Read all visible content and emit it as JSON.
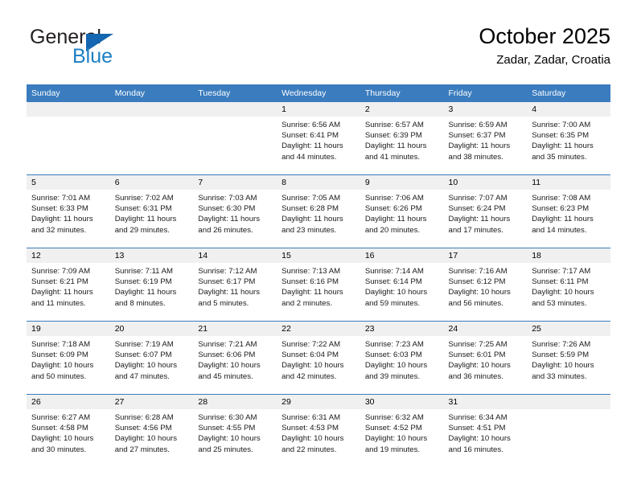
{
  "brand": {
    "name_general": "General",
    "name_blue": "Blue",
    "accent_color": "#1566b0",
    "blue_text_color": "#1c7fc4"
  },
  "header": {
    "title": "October 2025",
    "subtitle": "Zadar, Zadar, Croatia"
  },
  "calendar": {
    "header_bg": "#3a7cbe",
    "daynum_bg": "#f0f0f0",
    "weekday_headers": [
      "Sunday",
      "Monday",
      "Tuesday",
      "Wednesday",
      "Thursday",
      "Friday",
      "Saturday"
    ],
    "weeks": [
      [
        {
          "day": "",
          "sunrise": "",
          "sunset": "",
          "daylight_line1": "",
          "daylight_line2": ""
        },
        {
          "day": "",
          "sunrise": "",
          "sunset": "",
          "daylight_line1": "",
          "daylight_line2": ""
        },
        {
          "day": "",
          "sunrise": "",
          "sunset": "",
          "daylight_line1": "",
          "daylight_line2": ""
        },
        {
          "day": "1",
          "sunrise": "Sunrise: 6:56 AM",
          "sunset": "Sunset: 6:41 PM",
          "daylight_line1": "Daylight: 11 hours",
          "daylight_line2": "and 44 minutes."
        },
        {
          "day": "2",
          "sunrise": "Sunrise: 6:57 AM",
          "sunset": "Sunset: 6:39 PM",
          "daylight_line1": "Daylight: 11 hours",
          "daylight_line2": "and 41 minutes."
        },
        {
          "day": "3",
          "sunrise": "Sunrise: 6:59 AM",
          "sunset": "Sunset: 6:37 PM",
          "daylight_line1": "Daylight: 11 hours",
          "daylight_line2": "and 38 minutes."
        },
        {
          "day": "4",
          "sunrise": "Sunrise: 7:00 AM",
          "sunset": "Sunset: 6:35 PM",
          "daylight_line1": "Daylight: 11 hours",
          "daylight_line2": "and 35 minutes."
        }
      ],
      [
        {
          "day": "5",
          "sunrise": "Sunrise: 7:01 AM",
          "sunset": "Sunset: 6:33 PM",
          "daylight_line1": "Daylight: 11 hours",
          "daylight_line2": "and 32 minutes."
        },
        {
          "day": "6",
          "sunrise": "Sunrise: 7:02 AM",
          "sunset": "Sunset: 6:31 PM",
          "daylight_line1": "Daylight: 11 hours",
          "daylight_line2": "and 29 minutes."
        },
        {
          "day": "7",
          "sunrise": "Sunrise: 7:03 AM",
          "sunset": "Sunset: 6:30 PM",
          "daylight_line1": "Daylight: 11 hours",
          "daylight_line2": "and 26 minutes."
        },
        {
          "day": "8",
          "sunrise": "Sunrise: 7:05 AM",
          "sunset": "Sunset: 6:28 PM",
          "daylight_line1": "Daylight: 11 hours",
          "daylight_line2": "and 23 minutes."
        },
        {
          "day": "9",
          "sunrise": "Sunrise: 7:06 AM",
          "sunset": "Sunset: 6:26 PM",
          "daylight_line1": "Daylight: 11 hours",
          "daylight_line2": "and 20 minutes."
        },
        {
          "day": "10",
          "sunrise": "Sunrise: 7:07 AM",
          "sunset": "Sunset: 6:24 PM",
          "daylight_line1": "Daylight: 11 hours",
          "daylight_line2": "and 17 minutes."
        },
        {
          "day": "11",
          "sunrise": "Sunrise: 7:08 AM",
          "sunset": "Sunset: 6:23 PM",
          "daylight_line1": "Daylight: 11 hours",
          "daylight_line2": "and 14 minutes."
        }
      ],
      [
        {
          "day": "12",
          "sunrise": "Sunrise: 7:09 AM",
          "sunset": "Sunset: 6:21 PM",
          "daylight_line1": "Daylight: 11 hours",
          "daylight_line2": "and 11 minutes."
        },
        {
          "day": "13",
          "sunrise": "Sunrise: 7:11 AM",
          "sunset": "Sunset: 6:19 PM",
          "daylight_line1": "Daylight: 11 hours",
          "daylight_line2": "and 8 minutes."
        },
        {
          "day": "14",
          "sunrise": "Sunrise: 7:12 AM",
          "sunset": "Sunset: 6:17 PM",
          "daylight_line1": "Daylight: 11 hours",
          "daylight_line2": "and 5 minutes."
        },
        {
          "day": "15",
          "sunrise": "Sunrise: 7:13 AM",
          "sunset": "Sunset: 6:16 PM",
          "daylight_line1": "Daylight: 11 hours",
          "daylight_line2": "and 2 minutes."
        },
        {
          "day": "16",
          "sunrise": "Sunrise: 7:14 AM",
          "sunset": "Sunset: 6:14 PM",
          "daylight_line1": "Daylight: 10 hours",
          "daylight_line2": "and 59 minutes."
        },
        {
          "day": "17",
          "sunrise": "Sunrise: 7:16 AM",
          "sunset": "Sunset: 6:12 PM",
          "daylight_line1": "Daylight: 10 hours",
          "daylight_line2": "and 56 minutes."
        },
        {
          "day": "18",
          "sunrise": "Sunrise: 7:17 AM",
          "sunset": "Sunset: 6:11 PM",
          "daylight_line1": "Daylight: 10 hours",
          "daylight_line2": "and 53 minutes."
        }
      ],
      [
        {
          "day": "19",
          "sunrise": "Sunrise: 7:18 AM",
          "sunset": "Sunset: 6:09 PM",
          "daylight_line1": "Daylight: 10 hours",
          "daylight_line2": "and 50 minutes."
        },
        {
          "day": "20",
          "sunrise": "Sunrise: 7:19 AM",
          "sunset": "Sunset: 6:07 PM",
          "daylight_line1": "Daylight: 10 hours",
          "daylight_line2": "and 47 minutes."
        },
        {
          "day": "21",
          "sunrise": "Sunrise: 7:21 AM",
          "sunset": "Sunset: 6:06 PM",
          "daylight_line1": "Daylight: 10 hours",
          "daylight_line2": "and 45 minutes."
        },
        {
          "day": "22",
          "sunrise": "Sunrise: 7:22 AM",
          "sunset": "Sunset: 6:04 PM",
          "daylight_line1": "Daylight: 10 hours",
          "daylight_line2": "and 42 minutes."
        },
        {
          "day": "23",
          "sunrise": "Sunrise: 7:23 AM",
          "sunset": "Sunset: 6:03 PM",
          "daylight_line1": "Daylight: 10 hours",
          "daylight_line2": "and 39 minutes."
        },
        {
          "day": "24",
          "sunrise": "Sunrise: 7:25 AM",
          "sunset": "Sunset: 6:01 PM",
          "daylight_line1": "Daylight: 10 hours",
          "daylight_line2": "and 36 minutes."
        },
        {
          "day": "25",
          "sunrise": "Sunrise: 7:26 AM",
          "sunset": "Sunset: 5:59 PM",
          "daylight_line1": "Daylight: 10 hours",
          "daylight_line2": "and 33 minutes."
        }
      ],
      [
        {
          "day": "26",
          "sunrise": "Sunrise: 6:27 AM",
          "sunset": "Sunset: 4:58 PM",
          "daylight_line1": "Daylight: 10 hours",
          "daylight_line2": "and 30 minutes."
        },
        {
          "day": "27",
          "sunrise": "Sunrise: 6:28 AM",
          "sunset": "Sunset: 4:56 PM",
          "daylight_line1": "Daylight: 10 hours",
          "daylight_line2": "and 27 minutes."
        },
        {
          "day": "28",
          "sunrise": "Sunrise: 6:30 AM",
          "sunset": "Sunset: 4:55 PM",
          "daylight_line1": "Daylight: 10 hours",
          "daylight_line2": "and 25 minutes."
        },
        {
          "day": "29",
          "sunrise": "Sunrise: 6:31 AM",
          "sunset": "Sunset: 4:53 PM",
          "daylight_line1": "Daylight: 10 hours",
          "daylight_line2": "and 22 minutes."
        },
        {
          "day": "30",
          "sunrise": "Sunrise: 6:32 AM",
          "sunset": "Sunset: 4:52 PM",
          "daylight_line1": "Daylight: 10 hours",
          "daylight_line2": "and 19 minutes."
        },
        {
          "day": "31",
          "sunrise": "Sunrise: 6:34 AM",
          "sunset": "Sunset: 4:51 PM",
          "daylight_line1": "Daylight: 10 hours",
          "daylight_line2": "and 16 minutes."
        },
        {
          "day": "",
          "sunrise": "",
          "sunset": "",
          "daylight_line1": "",
          "daylight_line2": ""
        }
      ]
    ]
  }
}
